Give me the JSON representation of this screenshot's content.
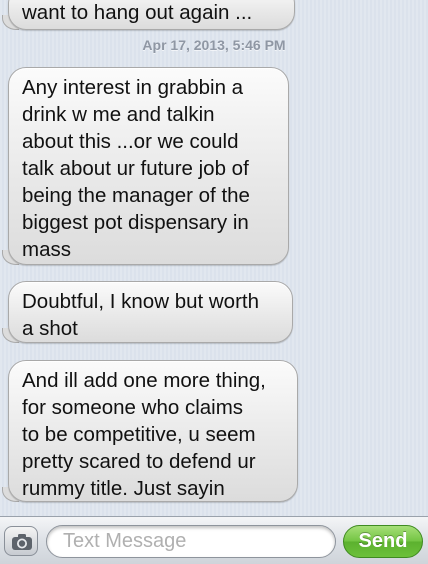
{
  "thread": {
    "timestamp": "Apr 17, 2013, 5:46 PM",
    "messages": [
      {
        "text": "want to hang out again ..."
      },
      {
        "text": "Any interest in grabbin a\ndrink w me and talkin\nabout this ...or we could\ntalk about ur future job of\nbeing the manager of the\nbiggest pot dispensary in\nmass"
      },
      {
        "text": "Doubtful, I know but worth\na shot"
      },
      {
        "text": "And ill add one more thing,\nfor someone who claims\nto be competitive, u seem\npretty scared to defend ur\nrummy title. Just sayin"
      }
    ]
  },
  "composer": {
    "camera_icon": "camera-icon",
    "input_placeholder": "Text Message",
    "send_label": "Send"
  },
  "colors": {
    "background": "#dbe2ec",
    "bubble": "#ececec",
    "send_button": "#6cc03a",
    "timestamp": "#8f97a4"
  }
}
